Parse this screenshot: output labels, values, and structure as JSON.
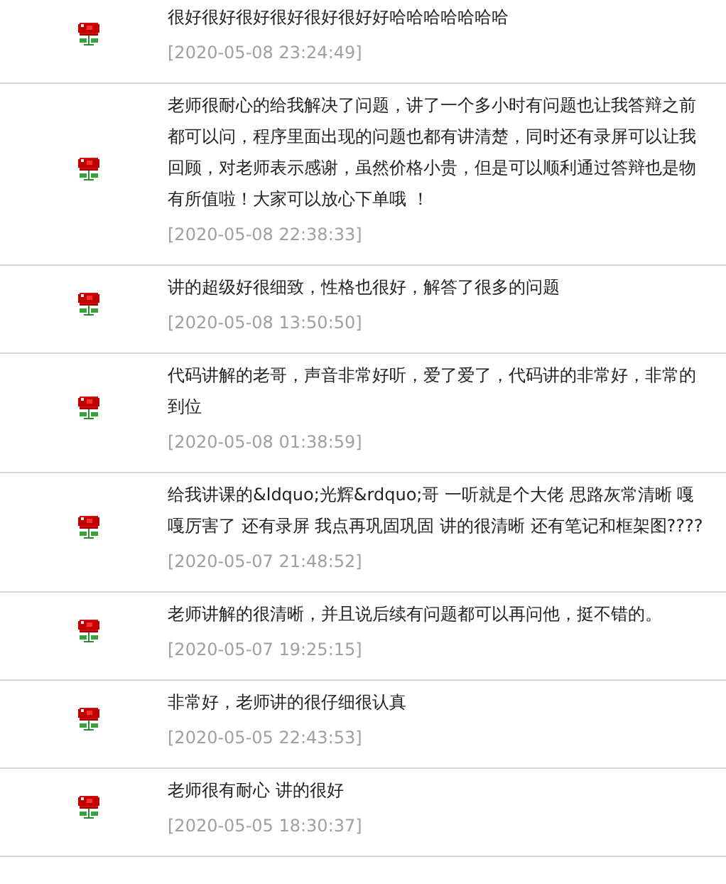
{
  "reviews": [
    {
      "text": "很好很好很好很好很好很好好哈哈哈哈哈哈哈",
      "time": "[2020-05-08 23:24:49]"
    },
    {
      "text": "老师很耐心的给我解决了问题，讲了一个多小时有问题也让我答辩之前都可以问，程序里面出现的问题也都有讲清楚，同时还有录屏可以让我回顾，对老师表示感谢，虽然价格小贵，但是可以顺利通过答辩也是物有所值啦！大家可以放心下单哦 ！",
      "time": "[2020-05-08 22:38:33]"
    },
    {
      "text": "讲的超级好很细致，性格也很好，解答了很多的问题",
      "time": "[2020-05-08 13:50:50]"
    },
    {
      "text": "代码讲解的老哥，声音非常好听，爱了爱了，代码讲的非常好，非常的到位",
      "time": "[2020-05-08 01:38:59]"
    },
    {
      "text": "给我讲课的&ldquo;光辉&rdquo;哥 一听就是个大佬 思路灰常清晰 嘎嘎厉害了 还有录屏 我点再巩固巩固 讲的很清晰 还有笔记和框架图????",
      "time": "[2020-05-07 21:48:52]"
    },
    {
      "text": "老师讲解的很清晰，并且说后续有问题都可以再问他，挺不错的。",
      "time": "[2020-05-07 19:25:15]"
    },
    {
      "text": "非常好，老师讲的很仔细很认真",
      "time": "[2020-05-05 22:43:53]"
    },
    {
      "text": "老师很有耐心 讲的很好",
      "time": "[2020-05-05 18:30:37]"
    }
  ]
}
